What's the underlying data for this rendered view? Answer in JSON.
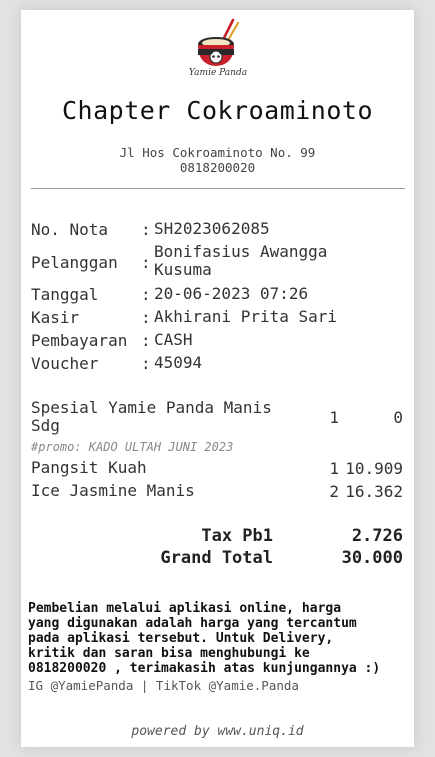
{
  "brand": {
    "logo_caption": "Yamie Panda",
    "accent": "#c8202a",
    "bowl_dark": "#2a2a2a"
  },
  "store": {
    "name": "Chapter Cokroaminoto",
    "address": "Jl Hos Cokroaminoto No. 99",
    "phone": "0818200020"
  },
  "info": [
    {
      "label": "No. Nota",
      "value": "SH2023062085"
    },
    {
      "label": "Pelanggan",
      "value": "Bonifasius Awangga Kusuma"
    },
    {
      "label": "Tanggal",
      "value": "20-06-2023 07:26"
    },
    {
      "label": "Kasir",
      "value": "Akhirani Prita Sari"
    },
    {
      "label": "Pembayaran",
      "value": "CASH"
    },
    {
      "label": "Voucher",
      "value": "45094"
    }
  ],
  "colon": ":",
  "items": [
    {
      "name": "Spesial Yamie Panda Manis Sdg",
      "qty": "1",
      "price": "0",
      "promo": "#promo: KADO ULTAH JUNI 2023"
    },
    {
      "name": "Pangsit Kuah",
      "qty": "1",
      "price": "10.909"
    },
    {
      "name": "Ice Jasmine Manis",
      "qty": "2",
      "price": "16.362"
    }
  ],
  "totals": [
    {
      "label": "Tax Pb1",
      "value": "2.726"
    },
    {
      "label": "Grand Total",
      "value": "30.000"
    }
  ],
  "footer": {
    "note": "Pembelian melalui aplikasi online, harga\nyang digunakan adalah harga yang tercantum\npada aplikasi tersebut. Untuk Delivery,\nkritik dan saran bisa menghubungi ke\n0818200020 , terimakasih atas kunjungannya :)",
    "social": "IG @YamiePanda | TikTok @Yamie.Panda",
    "powered_by": "powered by www.uniq.id"
  }
}
